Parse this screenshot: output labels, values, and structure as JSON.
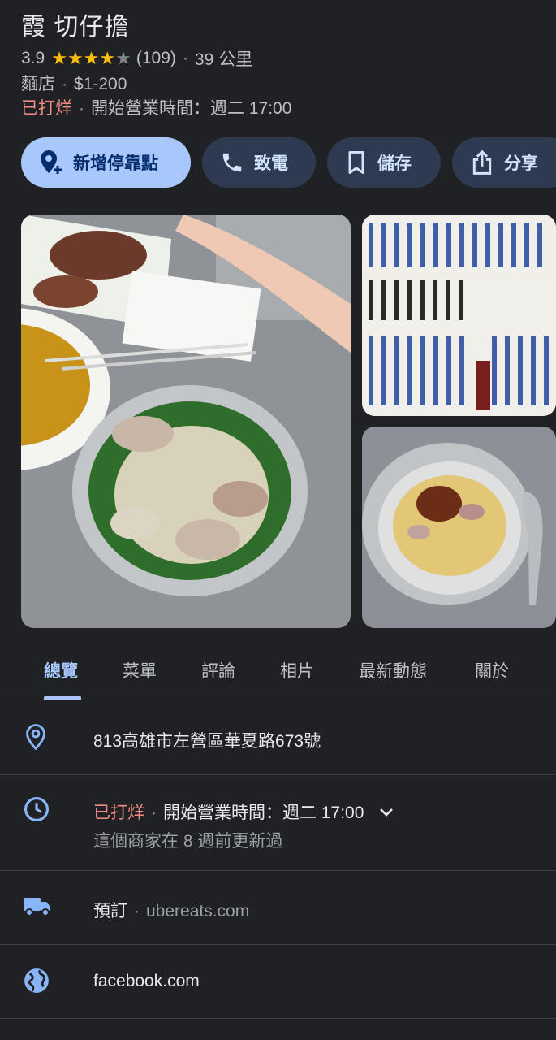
{
  "place": {
    "name": "霞 切仔擔",
    "rating": "3.9",
    "stars_filled": 4,
    "stars_total": 5,
    "review_count": "(109)",
    "distance": "39 公里",
    "category": "麵店",
    "price": "$1-200",
    "status": "已打烊",
    "opens": "開始營業時間：週二 17:00"
  },
  "actions": [
    {
      "label": "新增停靠點",
      "icon": "add-stop-icon"
    },
    {
      "label": "致電",
      "icon": "phone-icon"
    },
    {
      "label": "儲存",
      "icon": "bookmark-icon"
    },
    {
      "label": "分享",
      "icon": "share-icon"
    }
  ],
  "tabs": [
    "總覽",
    "菜單",
    "評論",
    "相片",
    "最新動態",
    "關於"
  ],
  "info": {
    "address": "813高雄市左營區華夏路673號",
    "hours_status": "已打烊",
    "hours_text": "開始營業時間：週二 17:00",
    "updated": "這個商家在 8 週前更新過",
    "order_label": "預訂",
    "order_site": "ubereats.com",
    "website": "facebook.com"
  },
  "colors": {
    "background": "#202124",
    "accent": "#a8c7fa",
    "closed": "#f28b82",
    "star": "#fbbc04"
  }
}
